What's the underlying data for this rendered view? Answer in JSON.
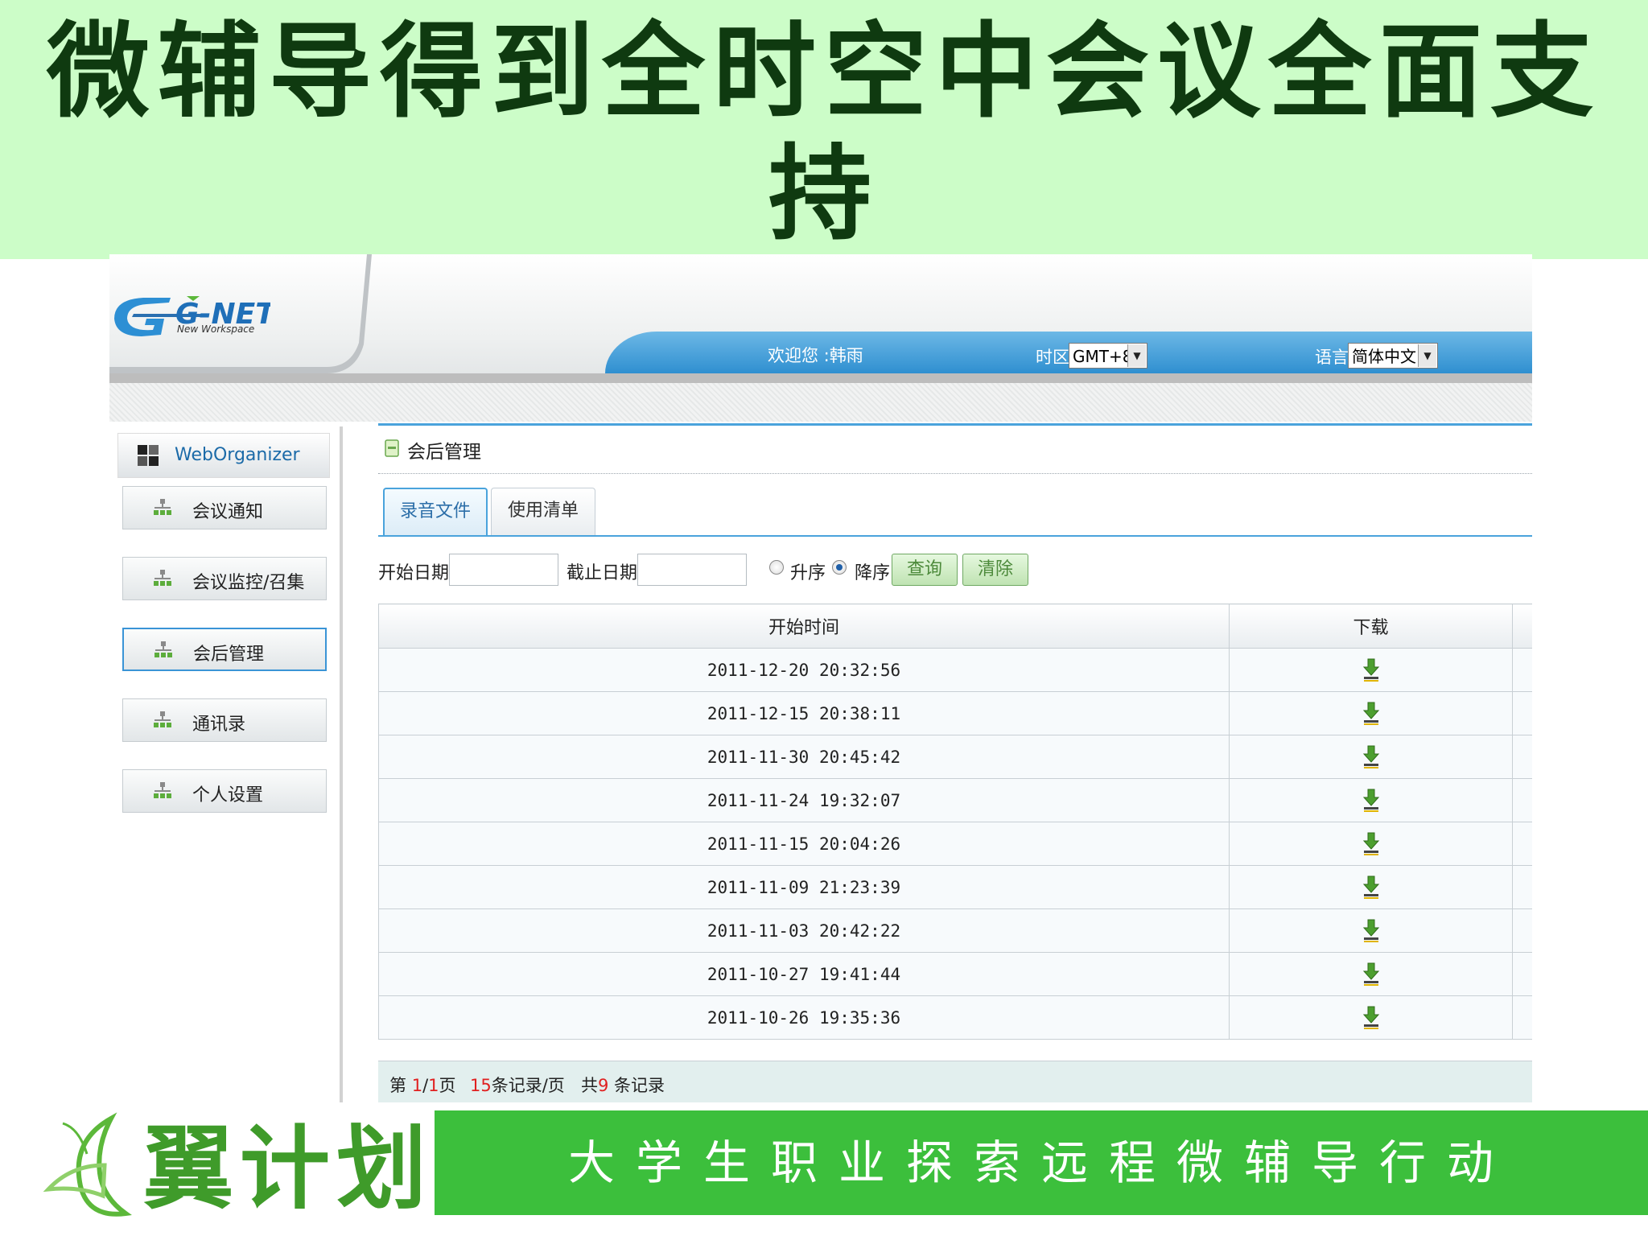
{
  "slide": {
    "title": "微辅导得到全时空中会议全面支持"
  },
  "app": {
    "logo_text": "G-NET",
    "logo_sub": "New Workspace",
    "welcome": "欢迎您 :韩雨",
    "timezone_label": "时区",
    "timezone_value": "GMT+8",
    "language_label": "语言",
    "language_value": "简体中文"
  },
  "sidebar": {
    "header": "WebOrganizer",
    "items": [
      {
        "label": "会议通知"
      },
      {
        "label": "会议监控/召集"
      },
      {
        "label": "会后管理",
        "active": true
      },
      {
        "label": "通讯录"
      },
      {
        "label": "个人设置"
      }
    ]
  },
  "main": {
    "section_title": "会后管理",
    "tabs": [
      {
        "label": "录音文件",
        "active": true
      },
      {
        "label": "使用清单"
      }
    ],
    "filter": {
      "start_label": "开始日期:",
      "end_label": "截止日期:",
      "asc_label": "升序",
      "desc_label": "降序",
      "order": "desc",
      "query_button": "查询",
      "clear_button": "清除"
    },
    "table": {
      "columns": [
        "开始时间",
        "下载"
      ],
      "rows": [
        {
          "start_time": "2011-12-20 20:32:56",
          "download_icon": "download-icon"
        },
        {
          "start_time": "2011-12-15 20:38:11",
          "download_icon": "download-icon"
        },
        {
          "start_time": "2011-11-30 20:45:42",
          "download_icon": "download-icon"
        },
        {
          "start_time": "2011-11-24 19:32:07",
          "download_icon": "download-icon"
        },
        {
          "start_time": "2011-11-15 20:04:26",
          "download_icon": "download-icon"
        },
        {
          "start_time": "2011-11-09 21:23:39",
          "download_icon": "download-icon"
        },
        {
          "start_time": "2011-11-03 20:42:22",
          "download_icon": "download-icon"
        },
        {
          "start_time": "2011-10-27 19:41:44",
          "download_icon": "download-icon"
        },
        {
          "start_time": "2011-10-26 19:35:36",
          "download_icon": "download-icon"
        }
      ]
    },
    "pagination": {
      "prefix": "第",
      "current_page": "1",
      "separator": "/",
      "total_pages": "1",
      "page_suffix": "页",
      "per_page": "15",
      "per_page_suffix": "条记录/页",
      "total_prefix": "共",
      "total_records": "9",
      "total_suffix": " 条记录"
    }
  },
  "footer": {
    "brand": "翼计划",
    "slogan": "大学生职业探索远程微辅导行动"
  },
  "colors": {
    "header_bg": "#ccfdc8",
    "title_text": "#0f3a10",
    "accent_blue": "#4aa3dc",
    "slogan_bg": "#3cbf3c",
    "brand_green": "#3f9b2a",
    "pagination_highlight": "#e02020"
  }
}
